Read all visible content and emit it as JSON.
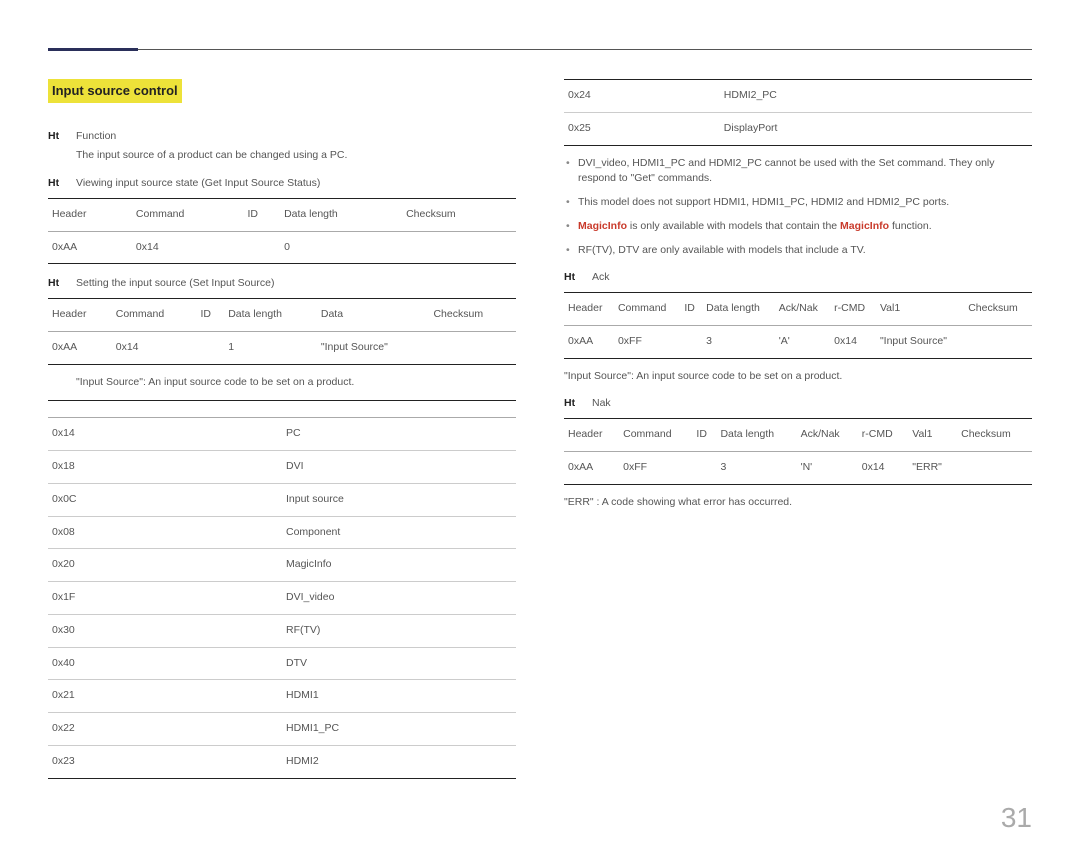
{
  "section_title": "Input source control",
  "left": {
    "func": {
      "label": "Function",
      "desc": "The input source of a product can be changed using a PC."
    },
    "view": {
      "label": "Viewing input source state (Get Input Source Status)"
    },
    "table_get": {
      "headers": [
        "Header",
        "Command",
        "ID",
        "Data length",
        "Checksum"
      ],
      "rows": [
        [
          "0xAA",
          "0x14",
          "",
          "0",
          ""
        ]
      ]
    },
    "set": {
      "label": "Setting the input source (Set Input Source)"
    },
    "table_set": {
      "headers": [
        "Header",
        "Command",
        "ID",
        "Data length",
        "Data",
        "Checksum"
      ],
      "rows": [
        [
          "0xAA",
          "0x14",
          "",
          "1",
          "\"Input Source\"",
          ""
        ]
      ]
    },
    "note_input_source": "\"Input Source\": An input source code to be set on a product.",
    "codes": {
      "headers": [
        "",
        ""
      ],
      "rows": [
        [
          "0x14",
          "PC"
        ],
        [
          "0x18",
          "DVI"
        ],
        [
          "0x0C",
          "Input source"
        ],
        [
          "0x08",
          "Component"
        ],
        [
          "0x20",
          "MagicInfo"
        ],
        [
          "0x1F",
          "DVI_video"
        ],
        [
          "0x30",
          "RF(TV)"
        ],
        [
          "0x40",
          "DTV"
        ],
        [
          "0x21",
          "HDMI1"
        ],
        [
          "0x22",
          "HDMI1_PC"
        ],
        [
          "0x23",
          "HDMI2"
        ]
      ]
    }
  },
  "right": {
    "codes_cont": {
      "rows": [
        [
          "0x24",
          "HDMI2_PC"
        ],
        [
          "0x25",
          "DisplayPort"
        ]
      ]
    },
    "bullets": [
      {
        "pre": "DVI_video, HDMI1_PC and HDMI2_PC cannot be used with the Set command. They only respond to \"Get\" commands."
      },
      {
        "pre": "This model does not support HDMI1, HDMI1_PC, HDMI2 and HDMI2_PC ports."
      },
      {
        "emph1": "MagicInfo",
        "mid": " is only available with models that contain the ",
        "emph2": "MagicInfo",
        "post": " function."
      },
      {
        "pre": "RF(TV), DTV are only available with models that include a TV."
      }
    ],
    "ack_label": "Ack",
    "table_ack": {
      "headers": [
        "Header",
        "Command",
        "ID",
        "Data length",
        "Ack/Nak",
        "r-CMD",
        "Val1",
        "Checksum"
      ],
      "rows": [
        [
          "0xAA",
          "0xFF",
          "",
          "3",
          "'A'",
          "0x14",
          "\"Input Source\"",
          ""
        ]
      ]
    },
    "note_input_source": "\"Input Source\": An input source code to be set on a product.",
    "nak_label": "Nak",
    "table_nak": {
      "headers": [
        "Header",
        "Command",
        "ID",
        "Data length",
        "Ack/Nak",
        "r-CMD",
        "Val1",
        "Checksum"
      ],
      "rows": [
        [
          "0xAA",
          "0xFF",
          "",
          "3",
          "'N'",
          "0x14",
          "\"ERR\"",
          ""
        ]
      ]
    },
    "err_note": "\"ERR\" : A code showing what error has occurred."
  },
  "page_number": "31"
}
